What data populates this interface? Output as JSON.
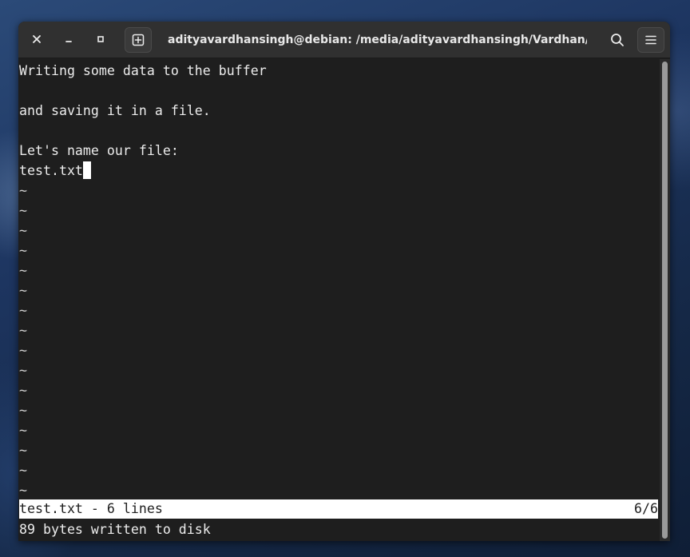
{
  "window": {
    "title": "adityavardhansingh@debian: /media/adityavardhansingh/Vardhan/Other/..."
  },
  "titlebar": {
    "close_icon": "close-icon",
    "minimize_icon": "minimize-icon",
    "maximize_icon": "maximize-icon",
    "new_tab_icon": "new-tab-icon",
    "search_icon": "search-icon",
    "menu_icon": "hamburger-menu-icon"
  },
  "editor": {
    "lines": [
      "Writing some data to the buffer",
      "",
      "and saving it in a file.",
      "",
      "Let's name our file:",
      "test.txt"
    ],
    "tilde": "~",
    "tilde_count": 16,
    "status_left": "test.txt - 6 lines",
    "status_right": "6/6",
    "message": "89 bytes written to disk"
  },
  "colors": {
    "terminal_bg": "#1e1e1e",
    "titlebar_bg": "#303030",
    "status_bg": "#ffffff",
    "text": "#ececec"
  }
}
